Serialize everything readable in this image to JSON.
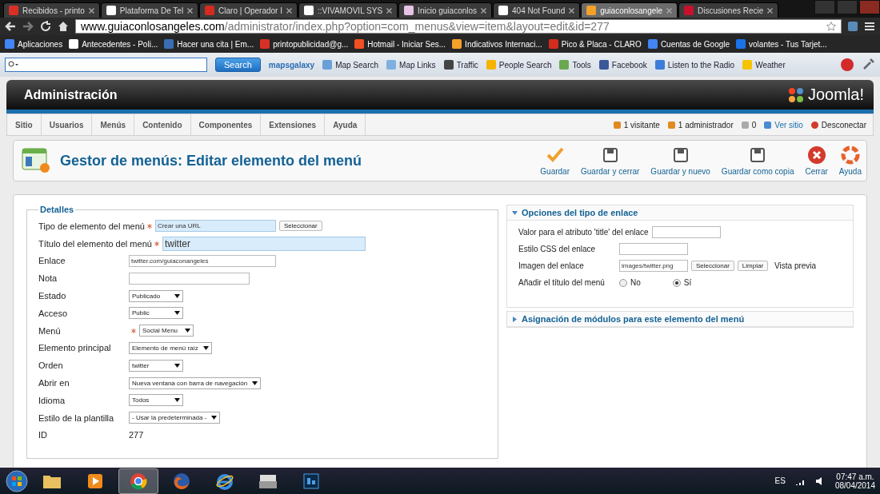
{
  "browser": {
    "tabs": [
      {
        "title": "Recibidos - printo",
        "selected": false
      },
      {
        "title": "Plataforma De Tel",
        "selected": false
      },
      {
        "title": "Claro | Operador I",
        "selected": false
      },
      {
        "title": "::VIVAMOVIL SYS",
        "selected": false
      },
      {
        "title": "Inicio guiaconlos",
        "selected": false
      },
      {
        "title": "404 Not Found",
        "selected": false
      },
      {
        "title": "guiaconlosangele",
        "selected": true
      },
      {
        "title": "Discusiones Recie",
        "selected": false
      }
    ],
    "url": {
      "host": "www.guiaconlosangeles.com",
      "path": "/administrator/index.php?option=com_menus&view=item&layout=edit&id=277"
    },
    "bookmarks": [
      "Aplicaciones",
      "Antecedentes - Poli...",
      "Hacer una cita | Em...",
      "printopublicidad@g...",
      "Hotmail - Iniciar Ses...",
      "Indicativos Internaci...",
      "Pico & Placa - CLARO",
      "Cuentas de Google",
      "volantes - Tus Tarjet..."
    ],
    "toolbar": {
      "search_button": "Search",
      "brand": "mapsgalaxy",
      "items": [
        "Map Search",
        "Map Links",
        "Traffic",
        "People Search",
        "Tools",
        "Facebook",
        "Listen to the Radio",
        "Weather"
      ]
    }
  },
  "admin": {
    "title": "Administración",
    "logo": "Joomla!",
    "menu": [
      "Sitio",
      "Usuarios",
      "Menús",
      "Contenido",
      "Componentes",
      "Extensiones",
      "Ayuda"
    ],
    "status": [
      "1 visitante",
      "1 administrador",
      "0",
      "Ver sitio",
      "Desconectar"
    ],
    "page_title": "Gestor de menús: Editar elemento del menú",
    "actions": [
      "Guardar",
      "Guardar y cerrar",
      "Guardar y nuevo",
      "Guardar como copia",
      "Cerrar",
      "Ayuda"
    ]
  },
  "details": {
    "legend": "Detalles",
    "fields": [
      {
        "kind": "chooser",
        "label": "Tipo de elemento del menú",
        "required": true,
        "value": "Crear una URL",
        "button": "Seleccionar"
      },
      {
        "kind": "title",
        "label": "Título del elemento del menú",
        "required": true,
        "value": "twitter"
      },
      {
        "kind": "input",
        "label": "Enlace",
        "required": false,
        "value": "twitter.com/guiaconangeles"
      },
      {
        "kind": "input",
        "label": "Nota",
        "required": false
      },
      {
        "kind": "select",
        "label": "Estado",
        "required": false,
        "value": "Publicado"
      },
      {
        "kind": "select",
        "label": "Acceso",
        "required": false,
        "value": "Public"
      },
      {
        "kind": "select",
        "label": "Menú",
        "required": true,
        "value": "Social Menu"
      },
      {
        "kind": "select",
        "label": "Elemento principal",
        "required": false,
        "value": "Elemento de menú raíz"
      },
      {
        "kind": "select",
        "label": "Orden",
        "required": false,
        "value": "twitter"
      },
      {
        "kind": "select",
        "label": "Abrir en",
        "required": false,
        "value": "Nueva ventana con barra de navegación"
      },
      {
        "kind": "select",
        "label": "Idioma",
        "required": false,
        "value": "Todos"
      },
      {
        "kind": "select",
        "label": "Estilo de la plantilla",
        "required": false,
        "value": "- Usar la predeterminada -"
      },
      {
        "kind": "static",
        "label": "ID",
        "required": false,
        "value": "277"
      }
    ]
  },
  "panels": [
    {
      "title": "Opciones del tipo de enlace",
      "expanded": true,
      "fields": [
        {
          "kind": "input",
          "label": "Valor para el atributo 'title' del enlace"
        },
        {
          "kind": "input",
          "label": "Estilo CSS del enlace"
        },
        {
          "kind": "image",
          "label": "Imagen del enlace",
          "value": "images/twitter.png",
          "buttons": [
            "Seleccionar",
            "Limpiar"
          ],
          "note": "Vista previa"
        },
        {
          "kind": "radio",
          "label": "Añadir el título del menú",
          "options": [
            {
              "label": "No",
              "selected": false
            },
            {
              "label": "Sí",
              "selected": true
            }
          ]
        }
      ]
    },
    {
      "title": "Asignación de módulos para este elemento del menú",
      "expanded": false
    }
  ],
  "taskbar": {
    "apps": [
      {
        "kind": "folder",
        "selected": false
      },
      {
        "kind": "media",
        "selected": false
      },
      {
        "kind": "chrome",
        "selected": true
      },
      {
        "kind": "firefox",
        "selected": false
      },
      {
        "kind": "ie",
        "selected": false
      },
      {
        "kind": "register",
        "selected": false
      },
      {
        "kind": "photoshop",
        "selected": false
      }
    ],
    "language": "ES",
    "time": "07:47 a.m.",
    "date": "08/04/2014"
  }
}
